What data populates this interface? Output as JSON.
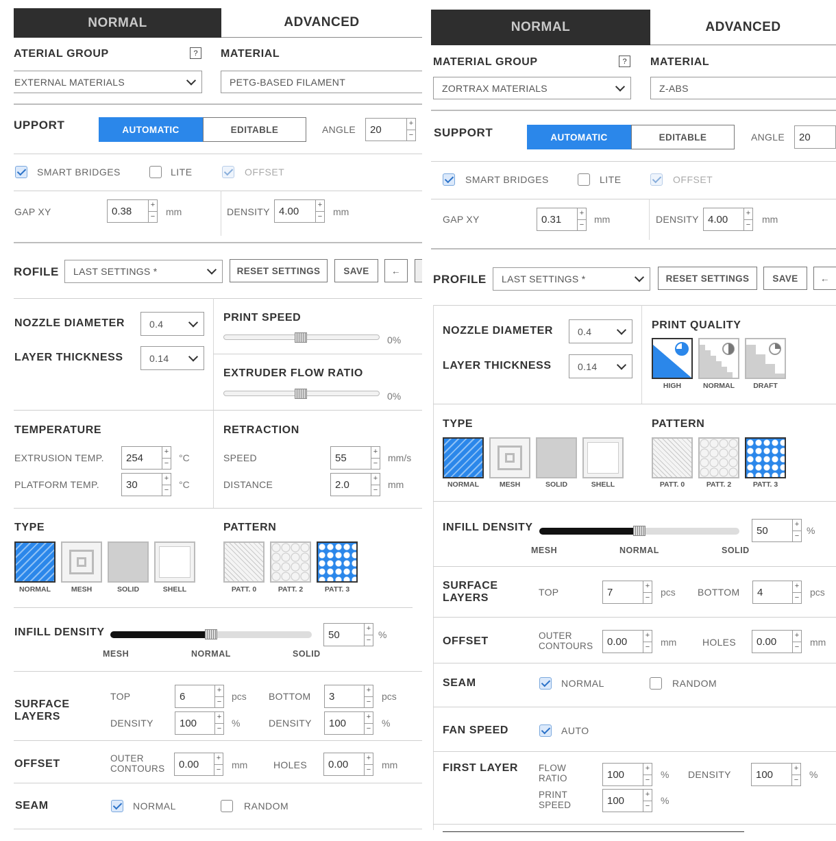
{
  "left": {
    "tabs": {
      "normal": "NORMAL",
      "advanced": "ADVANCED"
    },
    "material_group": {
      "label": "ATERIAL GROUP",
      "help": "?",
      "value": "EXTERNAL MATERIALS"
    },
    "material": {
      "label": "MATERIAL",
      "value": "PETG-BASED FILAMENT"
    },
    "support": {
      "label": "UPPORT",
      "automatic": "AUTOMATIC",
      "editable": "EDITABLE",
      "angle_label": "ANGLE",
      "angle": "20"
    },
    "checks": {
      "smart_bridges": "SMART BRIDGES",
      "lite": "LITE",
      "offset": "OFFSET"
    },
    "gap": {
      "label": "GAP XY",
      "value": "0.38",
      "unit": "mm"
    },
    "density": {
      "label": "DENSITY",
      "value": "4.00",
      "unit": "mm"
    },
    "profile": {
      "label": "ROFILE",
      "value": "LAST SETTINGS *",
      "reset": "RESET SETTINGS",
      "save": "SAVE",
      "back": "←"
    },
    "nozzle": {
      "label": "NOZZLE DIAMETER",
      "value": "0.4"
    },
    "layer": {
      "label": "LAYER THICKNESS",
      "value": "0.14"
    },
    "print_speed": {
      "label": "PRINT SPEED",
      "pct": "0%"
    },
    "flow": {
      "label": "EXTRUDER FLOW RATIO",
      "pct": "0%"
    },
    "temperature": {
      "label": "TEMPERATURE",
      "extrusion_label": "EXTRUSION TEMP.",
      "extrusion": "254",
      "platform_label": "PLATFORM TEMP.",
      "platform": "30",
      "unit": "°C"
    },
    "retraction": {
      "label": "RETRACTION",
      "speed_label": "SPEED",
      "speed": "55",
      "speed_unit": "mm/s",
      "distance_label": "DISTANCE",
      "distance": "2.0",
      "distance_unit": "mm"
    },
    "type": {
      "label": "TYPE",
      "items": [
        "NORMAL",
        "MESH",
        "SOLID",
        "SHELL"
      ]
    },
    "pattern": {
      "label": "PATTERN",
      "items": [
        "PATT. 0",
        "PATT. 2",
        "PATT. 3"
      ]
    },
    "infill": {
      "label": "INFILL DENSITY",
      "value": "50",
      "unit": "%",
      "mesh": "MESH",
      "normal": "NORMAL",
      "solid": "SOLID",
      "level": 0.5
    },
    "surface": {
      "label1": "SURFACE",
      "label2": "LAYERS",
      "top_label": "TOP",
      "top": "6",
      "bottom_label": "BOTTOM",
      "bottom": "3",
      "pcs": "pcs",
      "density_label": "DENSITY",
      "density_top": "100",
      "density_bottom": "100",
      "pct": "%"
    },
    "offset": {
      "label": "OFFSET",
      "outer1": "OUTER",
      "outer2": "CONTOURS",
      "outer": "0.00",
      "holes_label": "HOLES",
      "holes": "0.00",
      "unit": "mm"
    },
    "seam": {
      "label": "SEAM",
      "normal": "NORMAL",
      "random": "RANDOM"
    }
  },
  "right": {
    "tabs": {
      "normal": "NORMAL",
      "advanced": "ADVANCED"
    },
    "material_group": {
      "label": "MATERIAL GROUP",
      "help": "?",
      "value": "ZORTRAX MATERIALS"
    },
    "material": {
      "label": "MATERIAL",
      "value": "Z-ABS"
    },
    "support": {
      "label": "SUPPORT",
      "automatic": "AUTOMATIC",
      "editable": "EDITABLE",
      "angle_label": "ANGLE",
      "angle": "20"
    },
    "checks": {
      "smart_bridges": "SMART BRIDGES",
      "lite": "LITE",
      "offset": "OFFSET"
    },
    "gap": {
      "label": "GAP XY",
      "value": "0.31",
      "unit": "mm"
    },
    "density": {
      "label": "DENSITY",
      "value": "4.00",
      "unit": "mm"
    },
    "profile": {
      "label": "PROFILE",
      "value": "LAST SETTINGS *",
      "reset": "RESET SETTINGS",
      "save": "SAVE",
      "back": "←"
    },
    "nozzle": {
      "label": "NOZZLE DIAMETER",
      "value": "0.4"
    },
    "layer": {
      "label": "LAYER THICKNESS",
      "value": "0.14"
    },
    "quality": {
      "label": "PRINT QUALITY",
      "items": [
        "HIGH",
        "NORMAL",
        "DRAFT"
      ]
    },
    "type": {
      "label": "TYPE",
      "items": [
        "NORMAL",
        "MESH",
        "SOLID",
        "SHELL"
      ]
    },
    "pattern": {
      "label": "PATTERN",
      "items": [
        "PATT. 0",
        "PATT. 2",
        "PATT. 3"
      ]
    },
    "infill": {
      "label": "INFILL DENSITY",
      "value": "50",
      "unit": "%",
      "mesh": "MESH",
      "normal": "NORMAL",
      "solid": "SOLID",
      "level": 0.5
    },
    "surface": {
      "label1": "SURFACE",
      "label2": "LAYERS",
      "top_label": "TOP",
      "top": "7",
      "bottom_label": "BOTTOM",
      "bottom": "4",
      "pcs": "pcs"
    },
    "offset": {
      "label": "OFFSET",
      "outer1": "OUTER",
      "outer2": "CONTOURS",
      "outer": "0.00",
      "holes_label": "HOLES",
      "holes": "0.00",
      "unit": "mm"
    },
    "seam": {
      "label": "SEAM",
      "normal": "NORMAL",
      "random": "RANDOM"
    },
    "fan": {
      "label": "FAN SPEED",
      "auto": "AUTO"
    },
    "first_layer": {
      "label": "FIRST LAYER",
      "flow1": "FLOW",
      "flow2": "RATIO",
      "flow": "100",
      "speed1": "PRINT",
      "speed2": "SPEED",
      "speed": "100",
      "density_label": "DENSITY",
      "density": "100",
      "pct": "%"
    }
  },
  "colors": {
    "accent": "#2b87ea",
    "tab_dark": "#2e2e2e"
  }
}
